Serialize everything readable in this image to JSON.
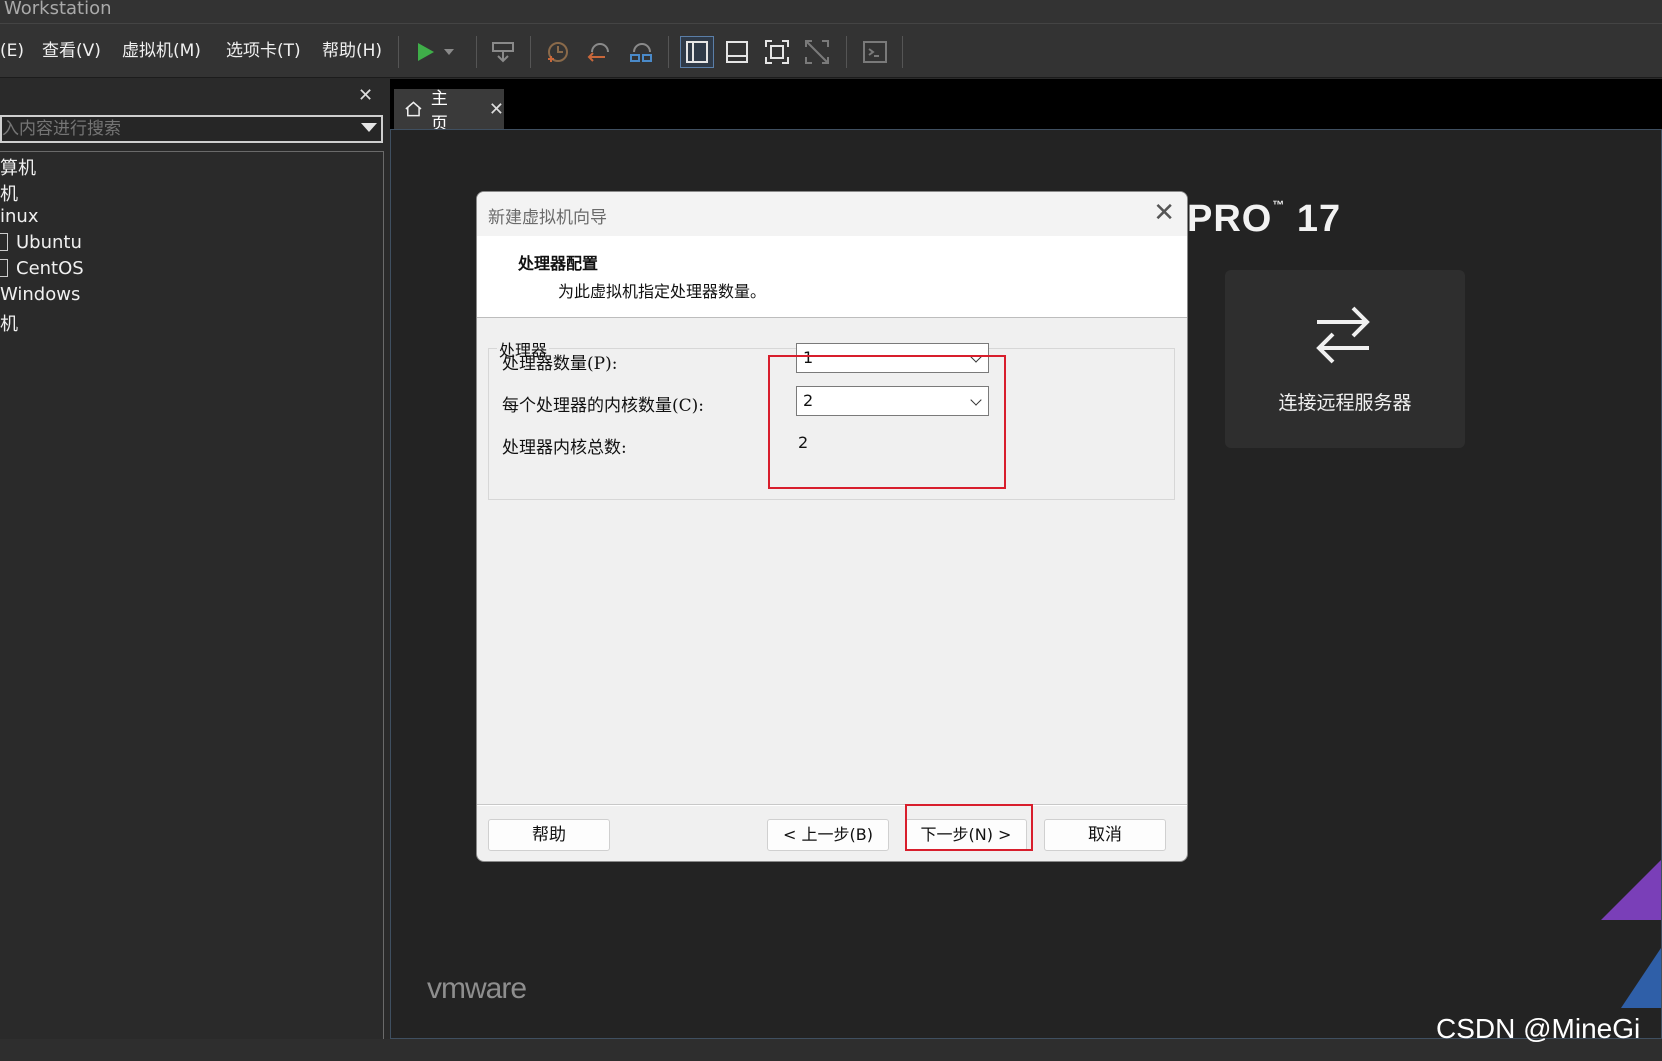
{
  "window": {
    "title": "Workstation"
  },
  "menu": [
    "(E)",
    "查看(V)",
    "虚拟机(M)",
    "选项卡(T)",
    "帮助(H)"
  ],
  "sidebar": {
    "search_placeholder": "入内容进行搜索",
    "tree": [
      "算机",
      "机",
      "inux",
      "Ubuntu",
      "CentOS",
      "Windows",
      "机"
    ]
  },
  "tabs": [
    {
      "label": "主页"
    }
  ],
  "home": {
    "brand": "PRO",
    "brand_tm": "™",
    "brand_version": "17",
    "card_label": "连接远程服务器",
    "vendor_logo": "vmware"
  },
  "dialog": {
    "title": "新建虚拟机向导",
    "heading": "处理器配置",
    "subheading": "为此虚拟机指定处理器数量。",
    "group_label": "处理器",
    "fields": {
      "processors_label": "处理器数量(P):",
      "processors_value": "1",
      "cores_label": "每个处理器的内核数量(C):",
      "cores_value": "2",
      "total_label": "处理器内核总数:",
      "total_value": "2"
    },
    "buttons": {
      "help": "帮助",
      "back": "< 上一步(B)",
      "next": "下一步(N) >",
      "cancel": "取消"
    }
  },
  "watermark": "CSDN @MineGi",
  "colors": {
    "highlight": "#d81e2c",
    "play": "#3fae49"
  }
}
